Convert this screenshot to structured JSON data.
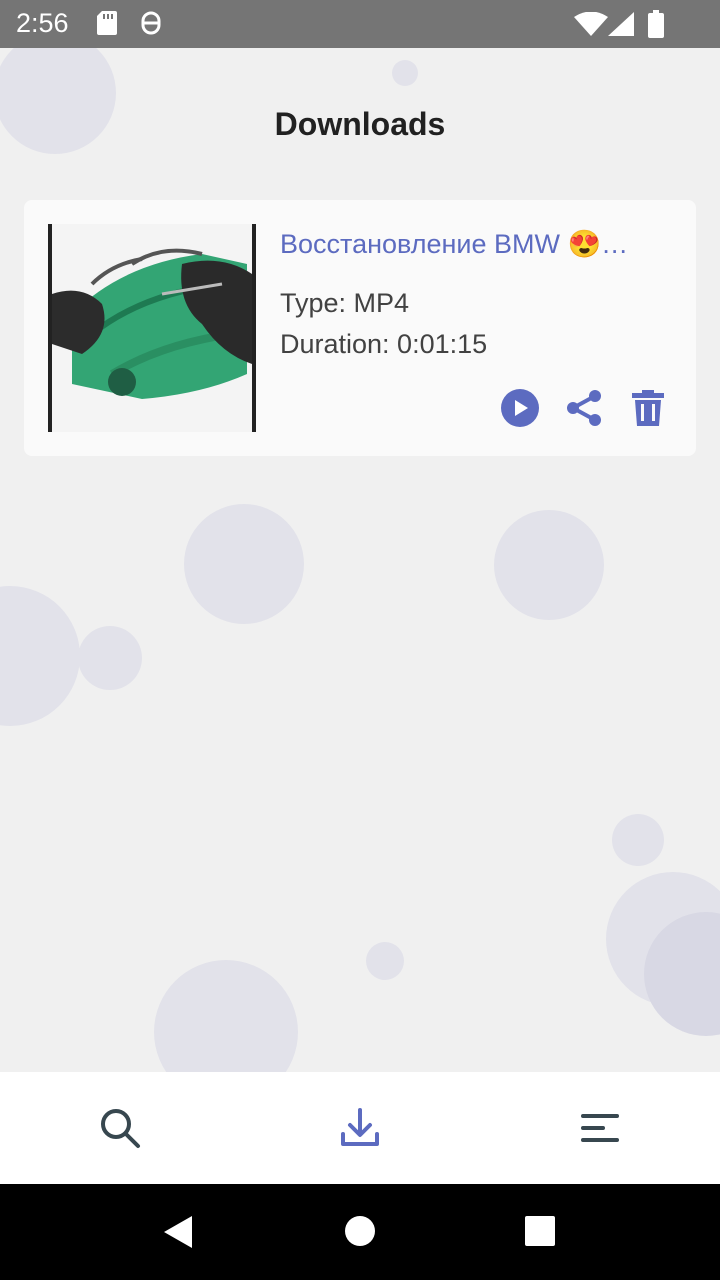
{
  "status_bar": {
    "time": "2:56",
    "icons": [
      "sd-card-icon",
      "sync-icon",
      "wifi-icon",
      "signal-icon",
      "battery-icon"
    ]
  },
  "page": {
    "title": "Downloads"
  },
  "downloads": [
    {
      "title": "Восстановление BMW 😍…",
      "type": "Type: MP4",
      "duration": "Duration: 0:01:15",
      "actions": [
        "play-icon",
        "share-icon",
        "delete-icon"
      ]
    }
  ],
  "bottom_nav": {
    "items": [
      "search-icon",
      "download-icon",
      "menu-icon"
    ],
    "active": "download-icon"
  },
  "colors": {
    "accent": "#5c6bc0",
    "background": "#f0f0f0",
    "status_bar": "#757575",
    "bubble": "#e2e2ea"
  }
}
